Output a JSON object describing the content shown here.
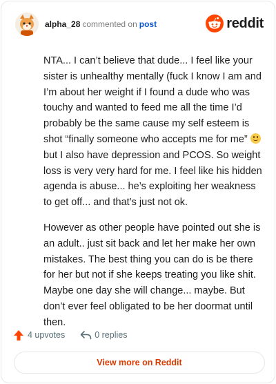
{
  "header": {
    "username": "alpha_28",
    "action_text": "commented on",
    "post_link": "post",
    "brand": "reddit"
  },
  "comment": {
    "paragraph_1_before_emoji": "NTA... I can’t believe that dude... I feel like your sister is unhealthy mentally (fuck I know I am and I’m about her weight if I found a dude who was touchy and wanted to feed me all the time I’d probably be the same cause my self esteem is shot “finally someone who accepts me for me”",
    "paragraph_1_after_emoji": " but I also have depression and PCOS. So weight loss is very very hard for me. I feel like his hidden agenda is abuse... he’s exploiting her weakness to get off... and that’s just not ok.",
    "paragraph_2": "However as other people have pointed out she is an adult.. just sit back and let her make her own mistakes. The best thing you can do is be there for her but not if she keeps treating you like shit. Maybe one day she will change... maybe. But don’t ever feel obligated to be her doormat until then."
  },
  "actions": {
    "upvotes_label": "4 upvotes",
    "replies_label": "0 replies"
  },
  "footer": {
    "view_more_label": "View more on Reddit"
  },
  "icons": {
    "avatar": "cartoon-fox-avatar-icon",
    "brand": "reddit-snoo-icon",
    "upvote": "upvote-arrow-icon",
    "reply": "reply-arrow-icon",
    "emoji": "grimacing-smile-emoji-icon"
  },
  "colors": {
    "brand_orange": "#ff4500",
    "upvote_orange": "#ff4500",
    "link_blue": "#0b57d0",
    "view_more_text": "#d93a00",
    "muted_text": "#7c7c7c",
    "border": "#e5e7eb"
  }
}
